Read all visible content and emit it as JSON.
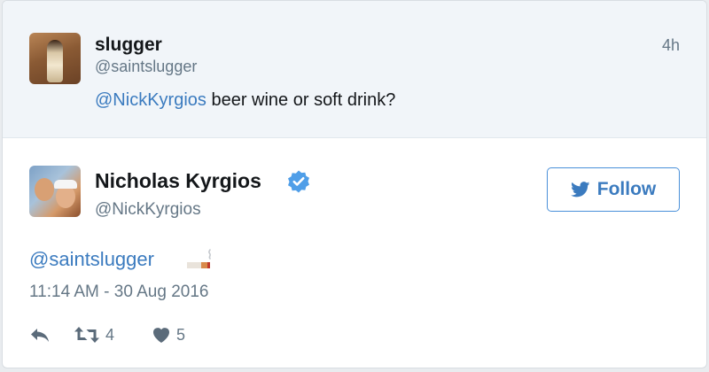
{
  "parent_tweet": {
    "name": "slugger",
    "handle": "@saintslugger",
    "time": "4h",
    "mention": "@NickKyrgios",
    "text": " beer wine or soft drink?"
  },
  "tweet": {
    "name": "Nicholas Kyrgios",
    "handle": "@NickKyrgios",
    "follow_label": "Follow",
    "mention": "@saintslugger",
    "timestamp": "11:14 AM - 30 Aug 2016",
    "retweets": "4",
    "likes": "5"
  },
  "icons": {
    "verified": "verified-badge-icon",
    "twitter_bird": "twitter-bird-icon",
    "reply": "reply-icon",
    "retweet": "retweet-icon",
    "like": "heart-icon",
    "emoji": "cigarette-emoji-icon"
  },
  "colors": {
    "accent": "#3b7bbf",
    "muted": "#657786",
    "parent_bg": "#f1f5f9"
  }
}
